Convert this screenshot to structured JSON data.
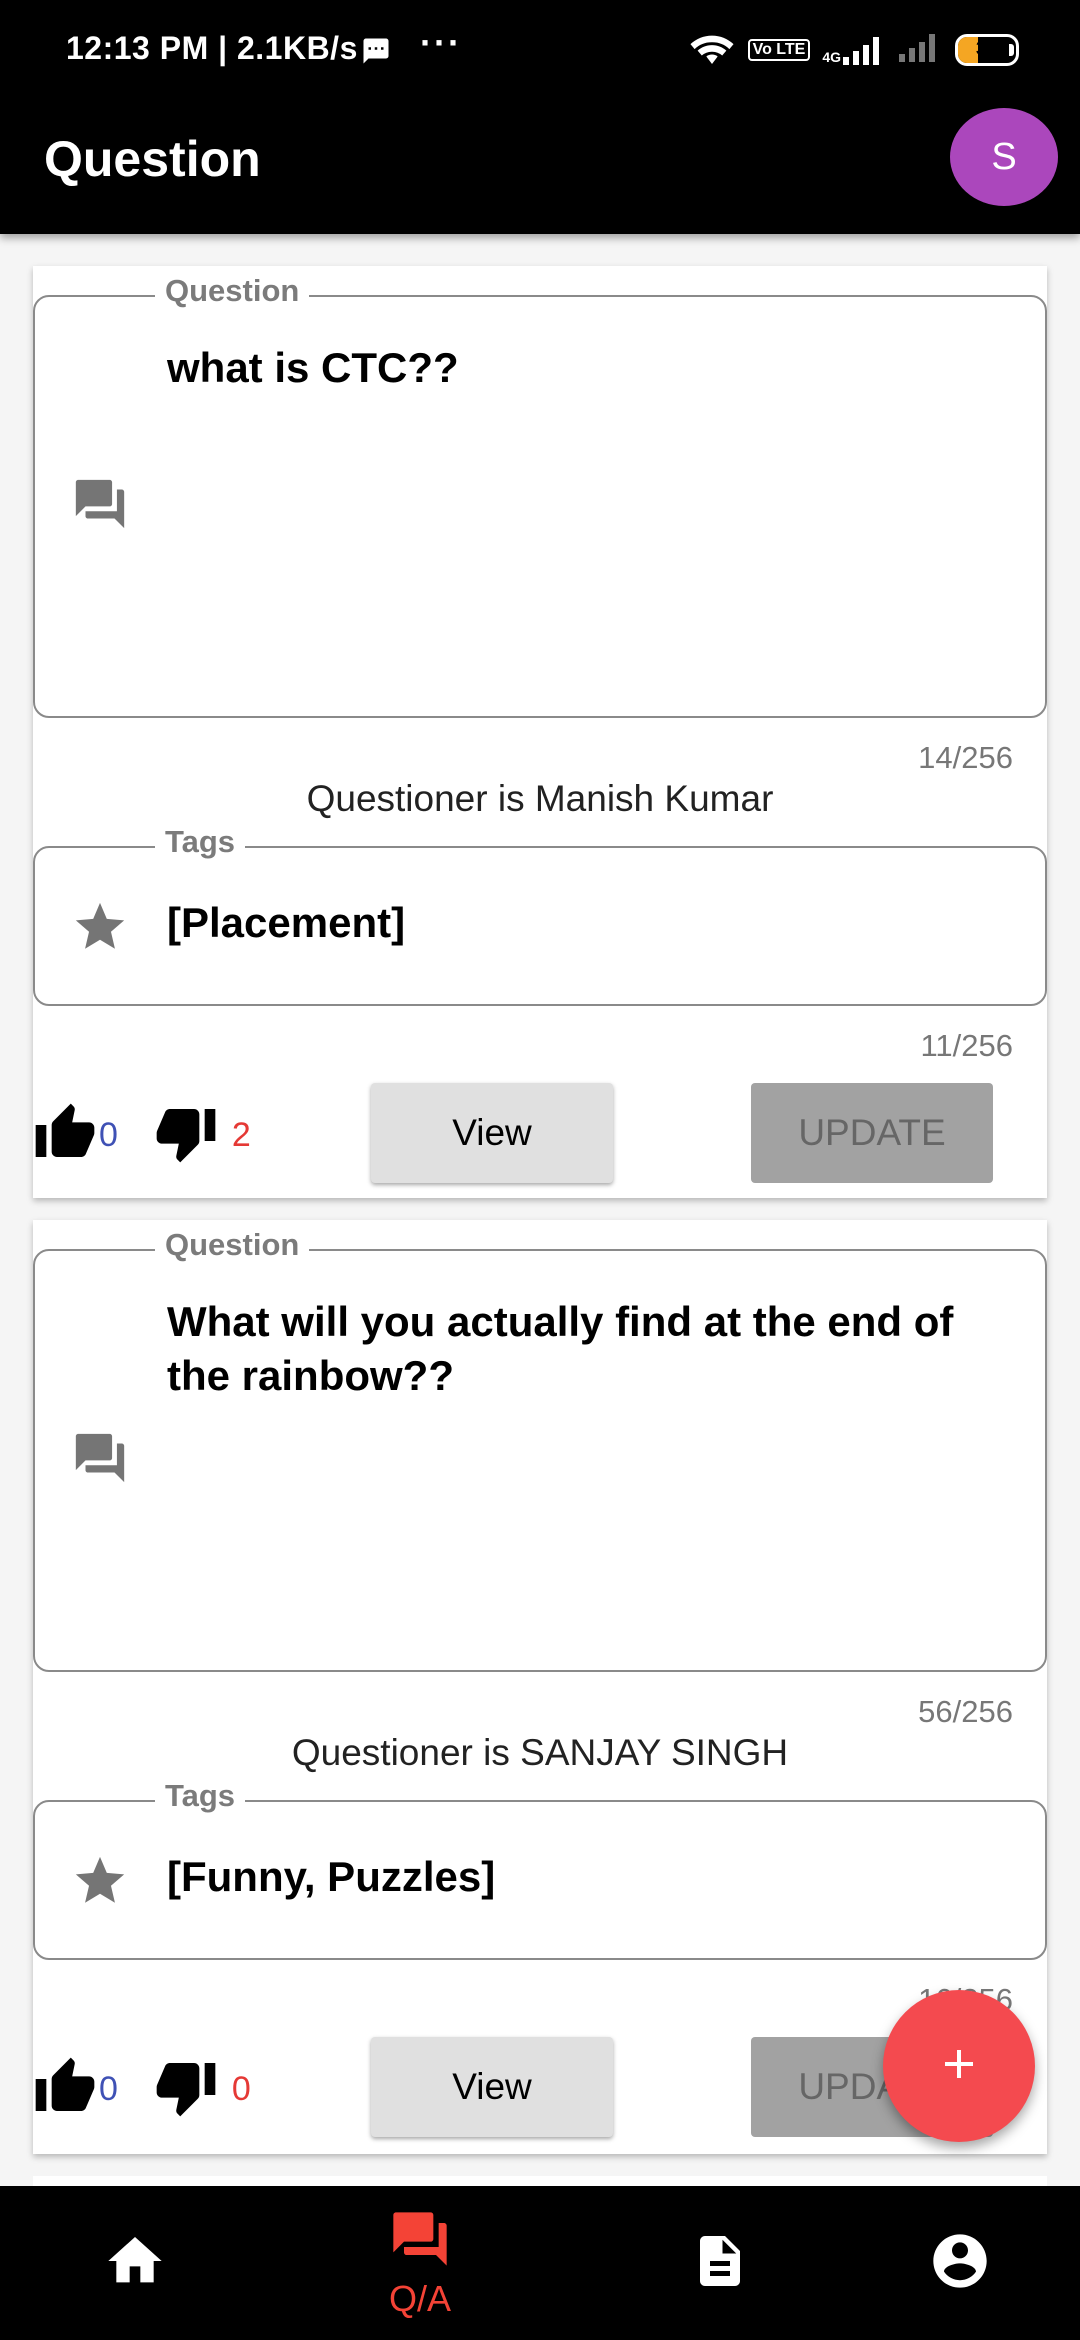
{
  "status_bar": {
    "time": "12:13 PM | 2.1KB/s",
    "volte": "Vo LTE",
    "network": "4G",
    "battery": "35",
    "battery_level": 0.35
  },
  "app_bar": {
    "title": "Question",
    "avatar_initial": "S"
  },
  "questions": [
    {
      "question_legend": "Question",
      "question_text": "what is CTC??",
      "question_counter": "14/256",
      "questioner": "Questioner is Manish Kumar",
      "tags_legend": "Tags",
      "tags": "[Placement]",
      "tags_counter": "11/256",
      "likes": "0",
      "dislikes": "2",
      "view_label": "View",
      "update_label": "UPDATE"
    },
    {
      "question_legend": "Question",
      "question_text": "What will you actually find at the end of the rainbow??",
      "question_counter": "56/256",
      "questioner": "Questioner is SANJAY SINGH",
      "tags_legend": "Tags",
      "tags": "[Funny, Puzzles]",
      "tags_counter": "16/256",
      "likes": "0",
      "dislikes": "0",
      "view_label": "View",
      "update_label": "UPDATE"
    }
  ],
  "fab": {
    "icon": "plus-icon"
  },
  "bottom_nav": {
    "items": [
      {
        "icon": "home-icon",
        "label": ""
      },
      {
        "icon": "forum-icon",
        "label": "Q/A",
        "active": true
      },
      {
        "icon": "document-icon",
        "label": ""
      },
      {
        "icon": "account-icon",
        "label": ""
      }
    ]
  },
  "colors": {
    "accent": "#f44336",
    "avatar": "#ab47bc",
    "like_count": "#3f51b5",
    "dislike_count": "#e53935"
  }
}
